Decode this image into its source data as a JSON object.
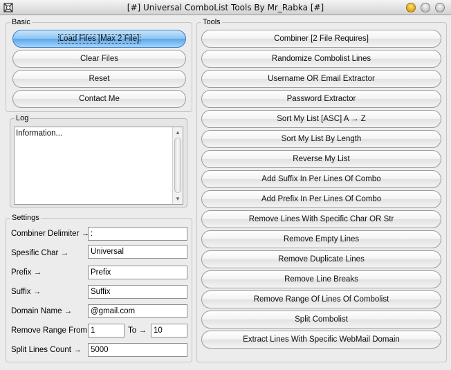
{
  "window": {
    "title": "[#] Universal ComboList Tools By Mr_Rabka [#]",
    "buttons": [
      "minimize-icon",
      "zoom-icon",
      "close-icon"
    ]
  },
  "basic": {
    "legend": "Basic",
    "buttons": [
      {
        "label": "Load Files [Max 2 File]"
      },
      {
        "label": "Clear Files"
      },
      {
        "label": "Reset"
      },
      {
        "label": "Contact Me"
      }
    ]
  },
  "log": {
    "legend": "Log",
    "text": "Information..."
  },
  "settings": {
    "legend": "Settings",
    "combiner_delimiter": {
      "label": "Combiner Delimiter →",
      "value": ":"
    },
    "specific_char": {
      "label": "Spesific Char →",
      "value": "Universal"
    },
    "prefix": {
      "label": "Prefix →",
      "value": "Prefix"
    },
    "suffix": {
      "label": "Suffix →",
      "value": "Suffix"
    },
    "domain_name": {
      "label": "Domain Name →",
      "value": "@gmail.com"
    },
    "remove_range": {
      "label": "Remove Range From :",
      "from": "1",
      "to_label": "To →",
      "to": "10"
    },
    "split_lines": {
      "label": "Split Lines Count →",
      "value": "5000"
    }
  },
  "tools": {
    "legend": "Tools",
    "buttons": [
      "Combiner [2 File Requires]",
      "Randomize Combolist Lines",
      "Username OR Email Extractor",
      "Password Extractor",
      "Sort My List [ASC] A → Z",
      "Sort My List By Length",
      "Reverse My List",
      "Add Suffix In Per Lines Of Combo",
      "Add Prefix In Per Lines Of Combo",
      "Remove Lines With Specific Char OR Str",
      "Remove Empty Lines",
      "Remove Duplicate Lines",
      "Remove Line Breaks",
      "Remove Range Of Lines Of Combolist",
      "Split Combolist",
      "Extract Lines With Specific WebMail Domain"
    ]
  },
  "colors": {
    "primary_button": "#5aa6ea",
    "window_bg": "#ececec",
    "minimize_yellow": "#e2a410"
  }
}
